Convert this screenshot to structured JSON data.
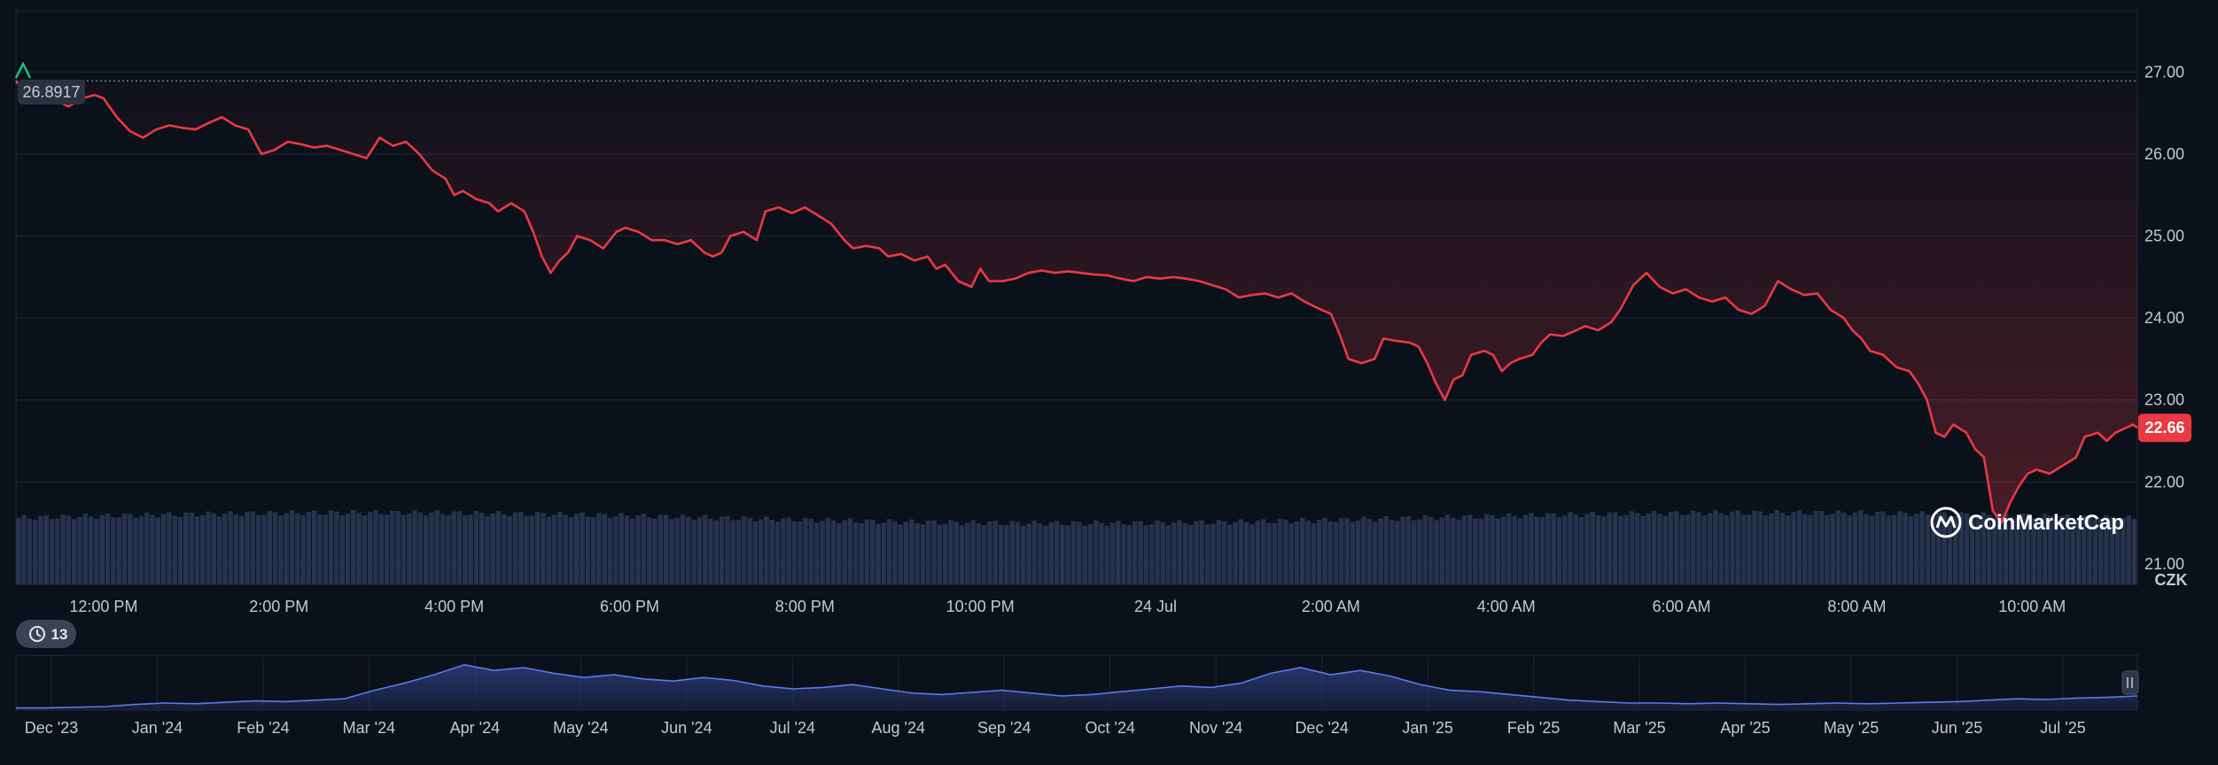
{
  "chart_data": {
    "type": "line",
    "currency_label": "CZK",
    "start_price_label": "26.8917",
    "current_price_label": "22.66",
    "current_price": 22.66,
    "start_price": 26.8917,
    "ylim": [
      20.75,
      27.75
    ],
    "y_ticks": [
      "27.00",
      "26.00",
      "25.00",
      "24.00",
      "23.00",
      "22.00",
      "21.00"
    ],
    "y_tick_values": [
      27,
      26,
      25,
      24,
      23,
      22,
      21
    ],
    "x_ticks": [
      "12:00 PM",
      "2:00 PM",
      "4:00 PM",
      "6:00 PM",
      "8:00 PM",
      "10:00 PM",
      "24 Jul",
      "2:00 AM",
      "4:00 AM",
      "6:00 AM",
      "8:00 AM",
      "10:00 AM"
    ],
    "x_tick_hours": [
      1,
      3,
      5,
      7,
      9,
      11,
      13,
      15,
      17,
      19,
      21,
      23
    ],
    "x_hours_range": [
      0,
      24.2
    ],
    "series": [
      {
        "points": [
          [
            0.0,
            26.89
          ],
          [
            0.15,
            26.7
          ],
          [
            0.3,
            26.62
          ],
          [
            0.45,
            26.66
          ],
          [
            0.6,
            26.58
          ],
          [
            0.75,
            26.68
          ],
          [
            0.9,
            26.72
          ],
          [
            1.0,
            26.68
          ],
          [
            1.15,
            26.45
          ],
          [
            1.3,
            26.28
          ],
          [
            1.45,
            26.2
          ],
          [
            1.6,
            26.3
          ],
          [
            1.75,
            26.35
          ],
          [
            1.9,
            26.32
          ],
          [
            2.05,
            26.3
          ],
          [
            2.2,
            26.38
          ],
          [
            2.35,
            26.45
          ],
          [
            2.5,
            26.35
          ],
          [
            2.65,
            26.3
          ],
          [
            2.8,
            26.0
          ],
          [
            2.95,
            26.05
          ],
          [
            3.1,
            26.15
          ],
          [
            3.25,
            26.12
          ],
          [
            3.4,
            26.08
          ],
          [
            3.55,
            26.1
          ],
          [
            3.7,
            26.05
          ],
          [
            3.85,
            26.0
          ],
          [
            4.0,
            25.95
          ],
          [
            4.15,
            26.2
          ],
          [
            4.3,
            26.1
          ],
          [
            4.45,
            26.15
          ],
          [
            4.6,
            26.0
          ],
          [
            4.75,
            25.8
          ],
          [
            4.9,
            25.7
          ],
          [
            5.0,
            25.5
          ],
          [
            5.1,
            25.55
          ],
          [
            5.25,
            25.45
          ],
          [
            5.4,
            25.4
          ],
          [
            5.5,
            25.3
          ],
          [
            5.65,
            25.4
          ],
          [
            5.8,
            25.3
          ],
          [
            5.9,
            25.05
          ],
          [
            6.0,
            24.75
          ],
          [
            6.1,
            24.55
          ],
          [
            6.2,
            24.7
          ],
          [
            6.3,
            24.8
          ],
          [
            6.4,
            25.0
          ],
          [
            6.55,
            24.95
          ],
          [
            6.7,
            24.85
          ],
          [
            6.85,
            25.05
          ],
          [
            6.95,
            25.1
          ],
          [
            7.1,
            25.05
          ],
          [
            7.25,
            24.95
          ],
          [
            7.4,
            24.95
          ],
          [
            7.55,
            24.9
          ],
          [
            7.7,
            24.95
          ],
          [
            7.85,
            24.8
          ],
          [
            7.95,
            24.75
          ],
          [
            8.05,
            24.8
          ],
          [
            8.15,
            25.0
          ],
          [
            8.3,
            25.05
          ],
          [
            8.45,
            24.95
          ],
          [
            8.55,
            25.3
          ],
          [
            8.7,
            25.35
          ],
          [
            8.85,
            25.28
          ],
          [
            9.0,
            25.35
          ],
          [
            9.15,
            25.25
          ],
          [
            9.3,
            25.15
          ],
          [
            9.45,
            24.95
          ],
          [
            9.55,
            24.85
          ],
          [
            9.7,
            24.88
          ],
          [
            9.85,
            24.85
          ],
          [
            9.95,
            24.75
          ],
          [
            10.1,
            24.78
          ],
          [
            10.25,
            24.7
          ],
          [
            10.4,
            24.75
          ],
          [
            10.5,
            24.6
          ],
          [
            10.6,
            24.65
          ],
          [
            10.75,
            24.45
          ],
          [
            10.9,
            24.38
          ],
          [
            11.0,
            24.6
          ],
          [
            11.1,
            24.45
          ],
          [
            11.25,
            24.45
          ],
          [
            11.4,
            24.48
          ],
          [
            11.55,
            24.55
          ],
          [
            11.7,
            24.58
          ],
          [
            11.85,
            24.55
          ],
          [
            12.0,
            24.57
          ],
          [
            12.15,
            24.55
          ],
          [
            12.3,
            24.53
          ],
          [
            12.45,
            24.52
          ],
          [
            12.6,
            24.48
          ],
          [
            12.75,
            24.45
          ],
          [
            12.9,
            24.5
          ],
          [
            13.05,
            24.48
          ],
          [
            13.2,
            24.5
          ],
          [
            13.35,
            24.48
          ],
          [
            13.5,
            24.45
          ],
          [
            13.65,
            24.4
          ],
          [
            13.8,
            24.35
          ],
          [
            13.95,
            24.25
          ],
          [
            14.1,
            24.28
          ],
          [
            14.25,
            24.3
          ],
          [
            14.4,
            24.25
          ],
          [
            14.55,
            24.3
          ],
          [
            14.7,
            24.2
          ],
          [
            14.85,
            24.12
          ],
          [
            15.0,
            24.05
          ],
          [
            15.1,
            23.8
          ],
          [
            15.2,
            23.5
          ],
          [
            15.35,
            23.45
          ],
          [
            15.5,
            23.5
          ],
          [
            15.6,
            23.75
          ],
          [
            15.75,
            23.72
          ],
          [
            15.9,
            23.7
          ],
          [
            16.0,
            23.65
          ],
          [
            16.1,
            23.45
          ],
          [
            16.2,
            23.2
          ],
          [
            16.3,
            23.0
          ],
          [
            16.4,
            23.25
          ],
          [
            16.5,
            23.3
          ],
          [
            16.6,
            23.55
          ],
          [
            16.75,
            23.6
          ],
          [
            16.85,
            23.55
          ],
          [
            16.95,
            23.35
          ],
          [
            17.05,
            23.45
          ],
          [
            17.15,
            23.5
          ],
          [
            17.3,
            23.55
          ],
          [
            17.4,
            23.7
          ],
          [
            17.5,
            23.8
          ],
          [
            17.65,
            23.78
          ],
          [
            17.8,
            23.85
          ],
          [
            17.9,
            23.9
          ],
          [
            18.05,
            23.85
          ],
          [
            18.2,
            23.95
          ],
          [
            18.3,
            24.1
          ],
          [
            18.45,
            24.4
          ],
          [
            18.6,
            24.55
          ],
          [
            18.75,
            24.38
          ],
          [
            18.9,
            24.3
          ],
          [
            19.05,
            24.35
          ],
          [
            19.2,
            24.25
          ],
          [
            19.35,
            24.2
          ],
          [
            19.5,
            24.25
          ],
          [
            19.65,
            24.1
          ],
          [
            19.8,
            24.05
          ],
          [
            19.95,
            24.15
          ],
          [
            20.1,
            24.45
          ],
          [
            20.25,
            24.35
          ],
          [
            20.4,
            24.28
          ],
          [
            20.55,
            24.3
          ],
          [
            20.7,
            24.1
          ],
          [
            20.85,
            24.0
          ],
          [
            20.95,
            23.85
          ],
          [
            21.05,
            23.75
          ],
          [
            21.15,
            23.6
          ],
          [
            21.3,
            23.55
          ],
          [
            21.45,
            23.4
          ],
          [
            21.6,
            23.35
          ],
          [
            21.7,
            23.2
          ],
          [
            21.8,
            23.0
          ],
          [
            21.9,
            22.6
          ],
          [
            22.0,
            22.55
          ],
          [
            22.1,
            22.7
          ],
          [
            22.25,
            22.6
          ],
          [
            22.35,
            22.4
          ],
          [
            22.45,
            22.3
          ],
          [
            22.55,
            21.65
          ],
          [
            22.65,
            21.5
          ],
          [
            22.75,
            21.75
          ],
          [
            22.85,
            21.95
          ],
          [
            22.95,
            22.1
          ],
          [
            23.05,
            22.15
          ],
          [
            23.2,
            22.1
          ],
          [
            23.35,
            22.2
          ],
          [
            23.5,
            22.3
          ],
          [
            23.6,
            22.55
          ],
          [
            23.75,
            22.6
          ],
          [
            23.85,
            22.5
          ],
          [
            23.95,
            22.6
          ],
          [
            24.05,
            22.65
          ],
          [
            24.15,
            22.7
          ],
          [
            24.2,
            22.66
          ]
        ]
      }
    ],
    "navigator": {
      "x_ticks": [
        "Dec '23",
        "Jan '24",
        "Feb '24",
        "Mar '24",
        "Apr '24",
        "May '24",
        "Jun '24",
        "Jul '24",
        "Aug '24",
        "Sep '24",
        "Oct '24",
        "Nov '24",
        "Dec '24",
        "Jan '25",
        "Feb '25",
        "Mar '25",
        "Apr '25",
        "May '25",
        "Jun '25",
        "Jul '25"
      ],
      "range_badge": "13",
      "values": [
        0.3,
        0.3,
        0.4,
        0.5,
        0.8,
        1.0,
        0.9,
        1.1,
        1.3,
        1.2,
        1.4,
        1.6,
        2.8,
        3.8,
        5.0,
        6.4,
        5.6,
        6.0,
        5.2,
        4.6,
        5.0,
        4.4,
        4.1,
        4.6,
        4.2,
        3.4,
        3.0,
        3.2,
        3.6,
        3.0,
        2.4,
        2.2,
        2.5,
        2.8,
        2.4,
        2.0,
        2.2,
        2.6,
        3.0,
        3.4,
        3.2,
        3.8,
        5.2,
        6.0,
        5.0,
        5.6,
        4.8,
        3.6,
        2.8,
        2.6,
        2.2,
        1.8,
        1.4,
        1.2,
        1.0,
        1.0,
        0.9,
        1.0,
        0.9,
        0.8,
        0.9,
        1.0,
        0.9,
        1.0,
        1.1,
        1.2,
        1.4,
        1.6,
        1.5,
        1.7,
        1.8,
        2.0
      ]
    }
  },
  "watermark": {
    "brand": "CoinMarketCap"
  },
  "colors": {
    "line": "#ea3943",
    "price_badge": "#ea3943",
    "volume": "#26324e",
    "navigator_line": "#5b7be8",
    "marker": "#16c784"
  }
}
